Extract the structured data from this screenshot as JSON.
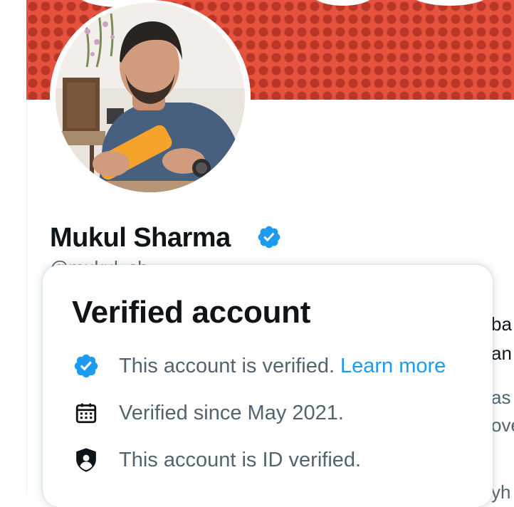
{
  "profile": {
    "name": "Mukul Sharma",
    "handle_partial": "@mukul_sh",
    "avatar": "profile-photo",
    "badge_icon": "verified-badge-icon",
    "banner_color": "#e5533e"
  },
  "background_text": {
    "line1": "ba",
    "line2": "an",
    "line3": "as",
    "line4": "ove",
    "line5": "yh"
  },
  "popover": {
    "title": "Verified account",
    "rows": [
      {
        "icon": "verified-badge-icon",
        "text": "This account is verified.",
        "link": "Learn more"
      },
      {
        "icon": "calendar-icon",
        "text": "Verified since May 2021."
      },
      {
        "icon": "id-shield-icon",
        "text": "This account is ID verified."
      }
    ]
  },
  "colors": {
    "accent": "#1d9bf0",
    "text_primary": "#0f1419",
    "text_secondary": "#536471"
  }
}
